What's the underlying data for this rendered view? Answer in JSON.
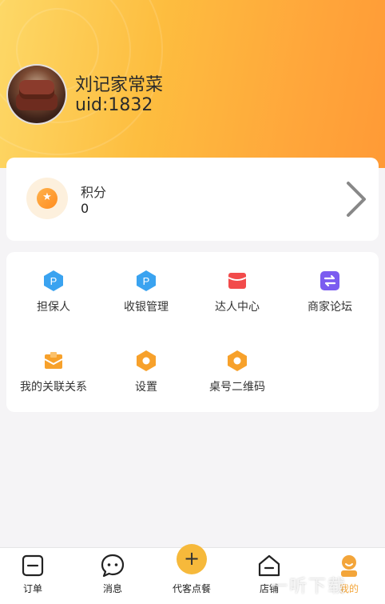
{
  "profile": {
    "shop_name": "刘记家常菜",
    "uid": "uid:1832"
  },
  "points": {
    "label": "积分",
    "value": "0"
  },
  "menu": {
    "items": [
      {
        "label": "担保人",
        "icon": "hexagon-p-icon"
      },
      {
        "label": "收银管理",
        "icon": "hexagon-p-icon"
      },
      {
        "label": "达人中心",
        "icon": "red-envelope-icon"
      },
      {
        "label": "商家论坛",
        "icon": "swap-arrows-icon"
      },
      {
        "label": "我的关联关系",
        "icon": "envelope-icon"
      },
      {
        "label": "设置",
        "icon": "hexagon-gear-icon"
      },
      {
        "label": "桌号二维码",
        "icon": "hexagon-qr-icon"
      }
    ]
  },
  "tabbar": {
    "items": [
      {
        "label": "订单",
        "icon": "order-icon"
      },
      {
        "label": "消息",
        "icon": "message-icon"
      },
      {
        "label": "代客点餐",
        "icon": "plus-icon"
      },
      {
        "label": "店铺",
        "icon": "store-icon"
      },
      {
        "label": "我的",
        "icon": "profile-icon"
      }
    ],
    "active": "我的"
  },
  "watermark": "一听下载",
  "colors": {
    "header_start": "#fdd867",
    "header_end": "#ff9a36",
    "accent": "#f3a53a",
    "blue_icon": "#3aa3f0",
    "red_icon": "#f24b4b",
    "purple_icon": "#7b5cf0",
    "orange_icon": "#f7a12b"
  }
}
